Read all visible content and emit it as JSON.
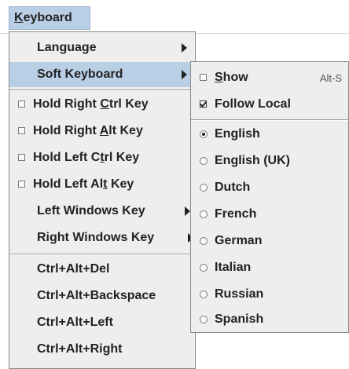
{
  "menubar": {
    "title_mnemonic": "K",
    "title_rest": "eyboard"
  },
  "main_menu": {
    "language": "Language",
    "soft_keyboard": "Soft Keyboard",
    "hold_right_ctrl": {
      "pre": "Hold Right ",
      "mn": "C",
      "post": "trl Key",
      "checked": false
    },
    "hold_right_alt": {
      "pre": "Hold Right ",
      "mn": "A",
      "post": "lt Key",
      "checked": false
    },
    "hold_left_ctrl": {
      "pre": "Hold Left C",
      "mn": "t",
      "post": "rl Key",
      "checked": false
    },
    "hold_left_alt": {
      "pre": "Hold Left Al",
      "mn": "t",
      "post": " Key",
      "checked": false
    },
    "left_windows_key": "Left Windows Key",
    "right_windows_key": "Right Windows Key",
    "ctrl_alt_del": "Ctrl+Alt+Del",
    "ctrl_alt_backspace": "Ctrl+Alt+Backspace",
    "ctrl_alt_left": "Ctrl+Alt+Left",
    "ctrl_alt_right": "Ctrl+Alt+Right"
  },
  "soft_keyboard_menu": {
    "show": {
      "mn": "S",
      "rest": "how",
      "accelerator": "Alt-S",
      "checked": false
    },
    "follow_local": {
      "label": "Follow Local",
      "checked": true
    },
    "languages": [
      {
        "label": "English",
        "selected": true
      },
      {
        "label": "English (UK)",
        "selected": false
      },
      {
        "label": "Dutch",
        "selected": false
      },
      {
        "label": "French",
        "selected": false
      },
      {
        "label": "German",
        "selected": false
      },
      {
        "label": "Italian",
        "selected": false
      },
      {
        "label": "Russian",
        "selected": false
      },
      {
        "label": "Spanish",
        "selected": false
      }
    ]
  },
  "colors": {
    "selection": "#b9cfe5",
    "menu_background": "#eeeeee"
  }
}
